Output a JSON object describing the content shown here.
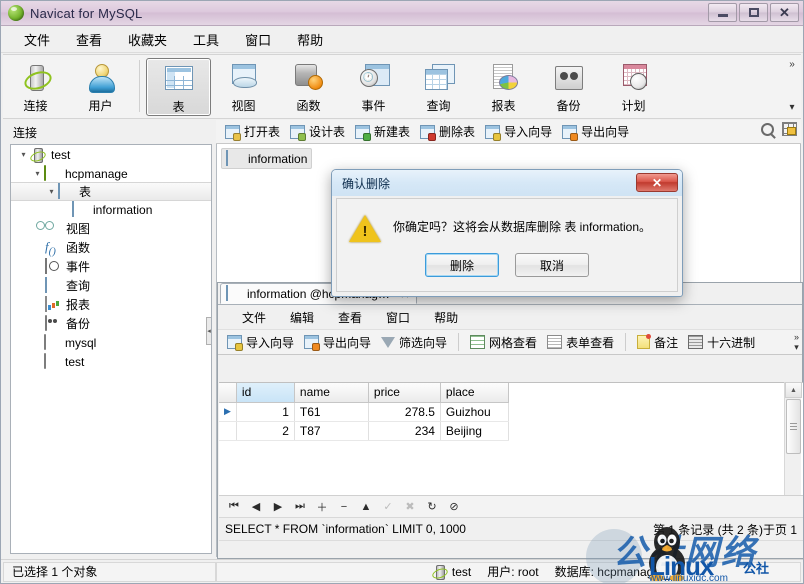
{
  "window": {
    "title": "Navicat for MySQL",
    "icon": "navicat-logo-icon",
    "minimize": "–",
    "maximize": "□",
    "close": "✕"
  },
  "menubar": {
    "items": [
      {
        "label": "文件"
      },
      {
        "label": "查看"
      },
      {
        "label": "收藏夹"
      },
      {
        "label": "工具"
      },
      {
        "label": "窗口"
      },
      {
        "label": "帮助"
      }
    ]
  },
  "toolbar": {
    "items": [
      {
        "label": "连接",
        "icon": "connection-icon",
        "selected": false
      },
      {
        "label": "用户",
        "icon": "user-icon",
        "selected": false
      },
      {
        "label": "表",
        "icon": "table-icon",
        "selected": true
      },
      {
        "label": "视图",
        "icon": "view-icon",
        "selected": false
      },
      {
        "label": "函数",
        "icon": "function-icon",
        "selected": false
      },
      {
        "label": "事件",
        "icon": "event-icon",
        "selected": false
      },
      {
        "label": "查询",
        "icon": "query-icon",
        "selected": false
      },
      {
        "label": "报表",
        "icon": "report-icon",
        "selected": false
      },
      {
        "label": "备份",
        "icon": "backup-icon",
        "selected": false
      },
      {
        "label": "计划",
        "icon": "schedule-icon",
        "selected": false
      }
    ],
    "overflow_more": "»",
    "overflow_down": "▾"
  },
  "actionbar": {
    "items": [
      {
        "label": "打开表",
        "icon": "open-table-icon",
        "badge": "badge-open"
      },
      {
        "label": "设计表",
        "icon": "design-table-icon",
        "badge": "badge-edit"
      },
      {
        "label": "新建表",
        "icon": "new-table-icon",
        "badge": "badge-new"
      },
      {
        "label": "删除表",
        "icon": "delete-table-icon",
        "badge": "badge-del"
      },
      {
        "label": "导入向导",
        "icon": "import-wizard-icon",
        "badge": "badge-imp"
      },
      {
        "label": "导出向导",
        "icon": "export-wizard-icon",
        "badge": "badge-exp"
      }
    ],
    "search_icon": "search-icon",
    "grid_icon": "grid-options-icon"
  },
  "sidebar": {
    "header": "连接",
    "nodes": [
      {
        "label": "test",
        "indent": 0,
        "icon": "connection-small-icon",
        "twisty": "▾",
        "selected": false
      },
      {
        "label": "hcpmanage",
        "indent": 1,
        "icon": "database-icon",
        "twisty": "▾",
        "selected": false
      },
      {
        "label": "表",
        "indent": 2,
        "icon": "tables-folder-icon",
        "twisty": "▾",
        "selected": true
      },
      {
        "label": "information",
        "indent": 3,
        "icon": "table-small-icon",
        "twisty": "",
        "selected": false
      },
      {
        "label": "视图",
        "indent": 2,
        "icon": "views-icon",
        "twisty": "",
        "selected": false
      },
      {
        "label": "函数",
        "indent": 2,
        "icon": "functions-icon",
        "twisty": "",
        "selected": false
      },
      {
        "label": "事件",
        "indent": 2,
        "icon": "events-icon",
        "twisty": "",
        "selected": false
      },
      {
        "label": "查询",
        "indent": 2,
        "icon": "queries-icon",
        "twisty": "",
        "selected": false
      },
      {
        "label": "报表",
        "indent": 2,
        "icon": "reports-icon",
        "twisty": "",
        "selected": false
      },
      {
        "label": "备份",
        "indent": 2,
        "icon": "backups-icon",
        "twisty": "",
        "selected": false
      },
      {
        "label": "mysql",
        "indent": 1,
        "icon": "database-gray-icon",
        "twisty": "",
        "selected": false
      },
      {
        "label": "test",
        "indent": 1,
        "icon": "database-gray-icon",
        "twisty": "",
        "selected": false
      }
    ]
  },
  "main": {
    "objects": [
      {
        "label": "information",
        "icon": "table-small-icon"
      }
    ]
  },
  "table_window": {
    "tab_label": "information @hcpmanag…",
    "tab_icon": "table-small-icon",
    "tab_close": "✕",
    "menu": [
      {
        "label": "文件"
      },
      {
        "label": "编辑"
      },
      {
        "label": "查看"
      },
      {
        "label": "窗口"
      },
      {
        "label": "帮助"
      }
    ],
    "toolbar": [
      {
        "label": "导入向导",
        "icon": "import-wizard-icon"
      },
      {
        "label": "导出向导",
        "icon": "export-wizard-icon"
      },
      {
        "label": "筛选向导",
        "icon": "filter-wizard-icon"
      },
      {
        "label": "网格查看",
        "icon": "grid-view-icon"
      },
      {
        "label": "表单查看",
        "icon": "form-view-icon"
      },
      {
        "label": "备注",
        "icon": "memo-icon"
      },
      {
        "label": "十六进制",
        "icon": "hex-icon"
      }
    ],
    "overflow_more": "»",
    "overflow_down": "▾",
    "grid": {
      "columns": [
        "id",
        "name",
        "price",
        "place"
      ],
      "rows": [
        {
          "id": "1",
          "name": "T61",
          "price": "278.5",
          "place": "Guizhou",
          "current": true
        },
        {
          "id": "2",
          "name": "T87",
          "price": "234",
          "place": "Beijing",
          "current": false
        }
      ],
      "row_marker": "▶"
    },
    "nav_buttons": [
      {
        "icon": "first-record-icon",
        "glyph": "⏮",
        "enabled": true
      },
      {
        "icon": "prev-record-icon",
        "glyph": "◀",
        "enabled": true
      },
      {
        "icon": "next-record-icon",
        "glyph": "▶",
        "enabled": true
      },
      {
        "icon": "last-record-icon",
        "glyph": "⏭",
        "enabled": true
      },
      {
        "icon": "add-record-icon",
        "glyph": "＋",
        "enabled": true
      },
      {
        "icon": "delete-record-icon",
        "glyph": "−",
        "enabled": true
      },
      {
        "icon": "edit-record-icon",
        "glyph": "▲",
        "enabled": true
      },
      {
        "icon": "apply-change-icon",
        "glyph": "✓",
        "enabled": false
      },
      {
        "icon": "cancel-change-icon",
        "glyph": "✖",
        "enabled": false
      },
      {
        "icon": "refresh-icon",
        "glyph": "↻",
        "enabled": true
      },
      {
        "icon": "stop-icon",
        "glyph": "⊘",
        "enabled": true
      }
    ],
    "sql": "SELECT * FROM `information` LIMIT 0, 1000",
    "record_info": "第 1 条记录 (共 2 条)于页 1"
  },
  "dialog": {
    "title": "确认删除",
    "close_glyph": "✕",
    "warning_icon": "warning-triangle-icon",
    "message": "你确定吗？这将会从数据库删除 表 information。",
    "confirm_label": "删除",
    "cancel_label": "取消"
  },
  "statusbar": {
    "selection": "已选择 1 个对象",
    "connection_icon": "connection-small-icon",
    "connection": "test",
    "user": "用户: root",
    "database": "数据库: hcpmanage"
  },
  "watermark": {
    "cn_text": "公社网络",
    "en_text": "Linux",
    "sub_text": "公社",
    "url": "www.linuxidc.com"
  },
  "colors": {
    "title_bar": "#ddc9dd",
    "accent_blue": "#3c9bdb",
    "selection_blue": "#c9e4f7",
    "warning_yellow": "#efc31c",
    "close_red": "#c03a2e",
    "watermark_blue": "#1156a8"
  }
}
